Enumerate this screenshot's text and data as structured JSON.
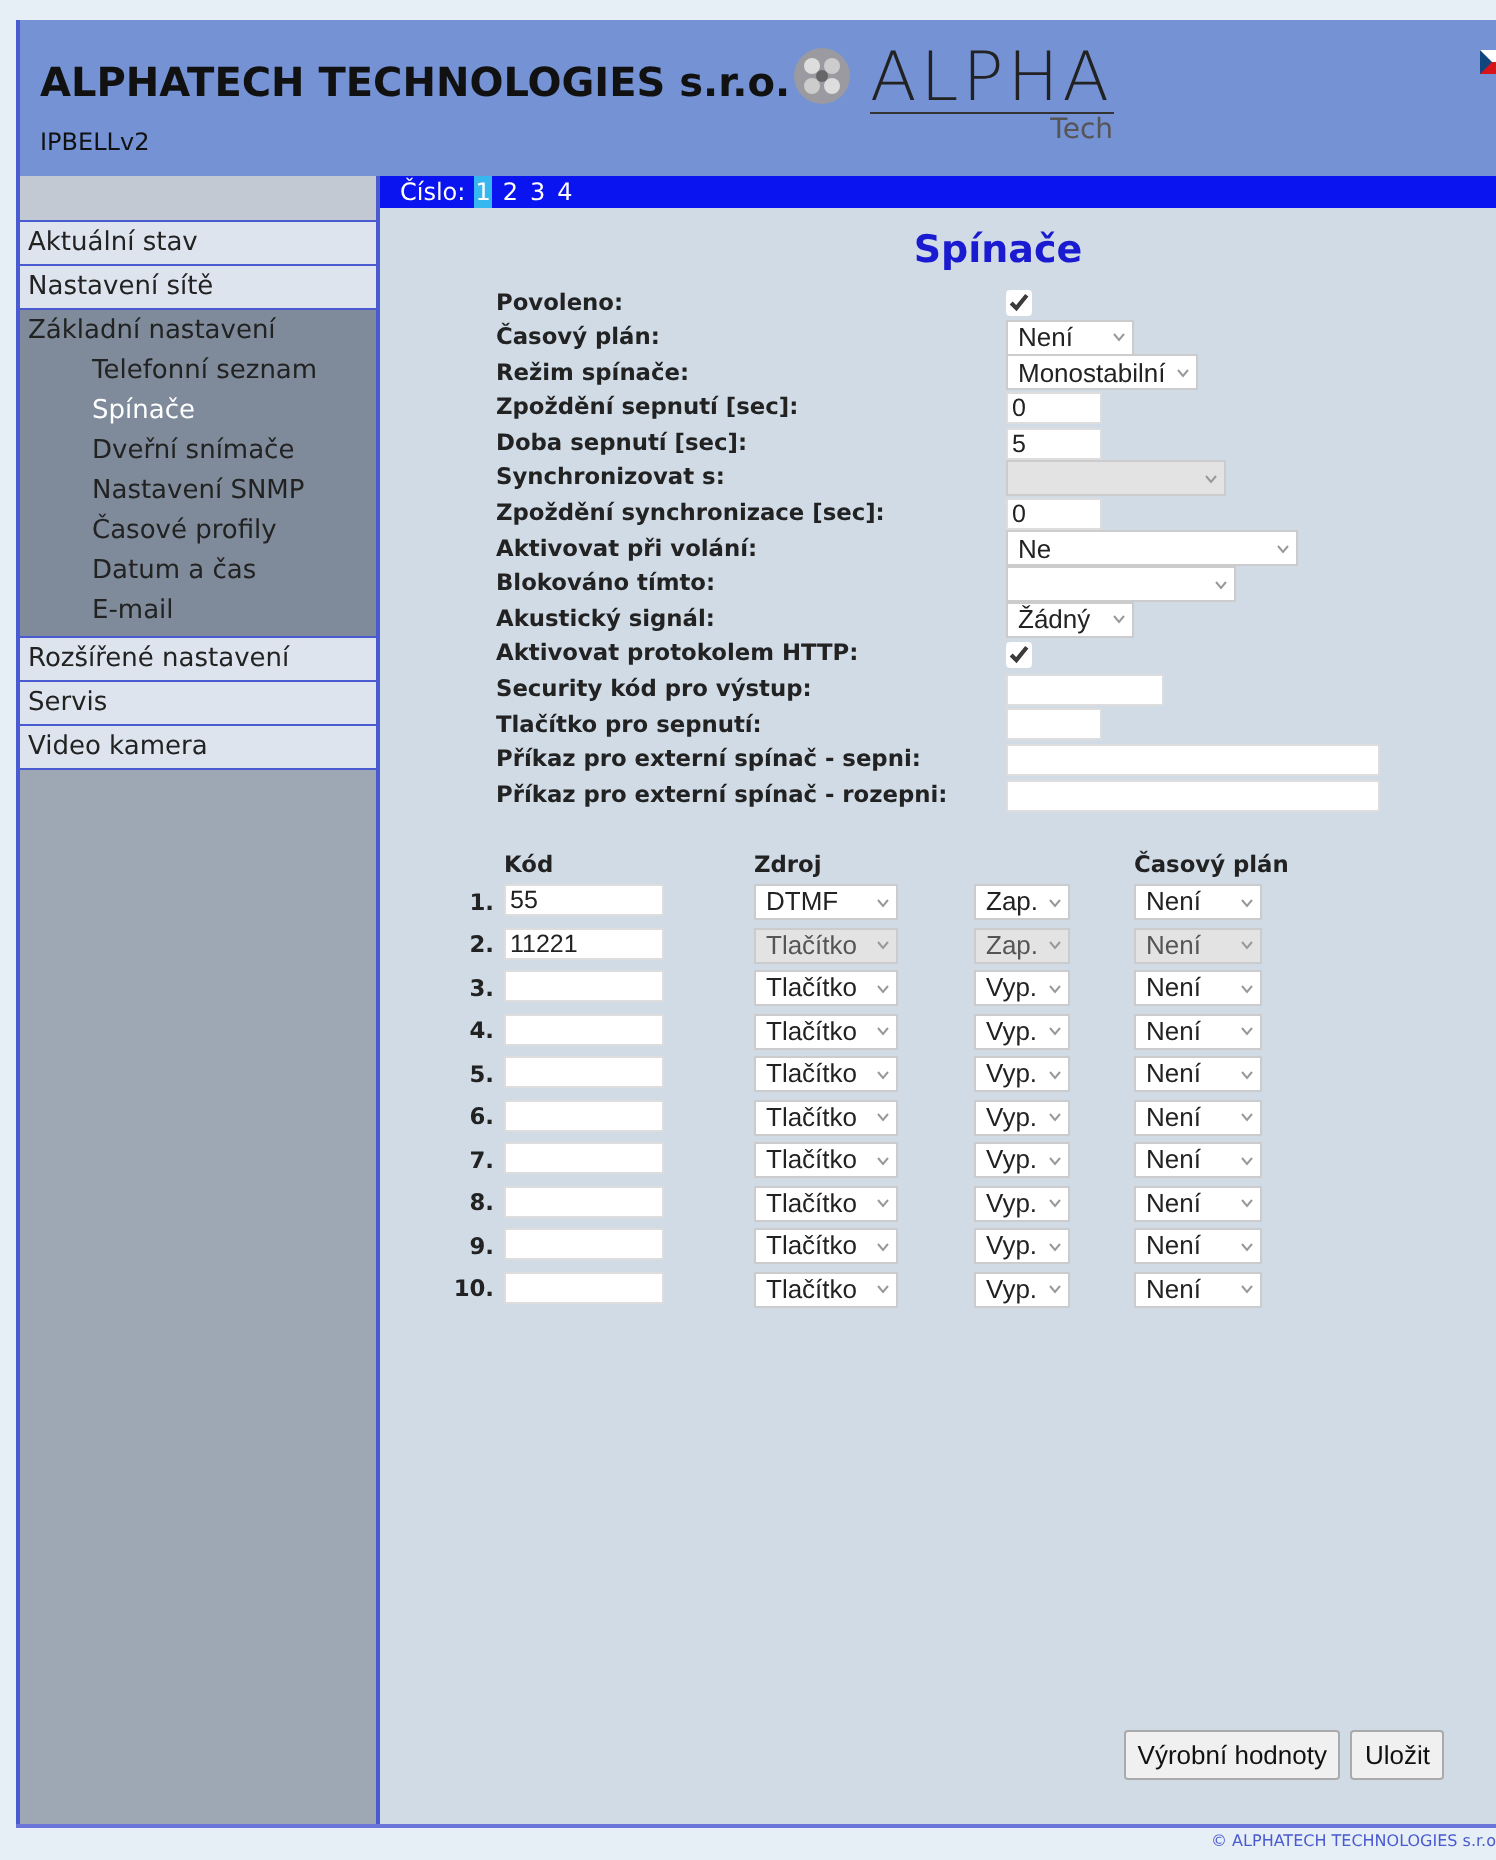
{
  "header": {
    "company": "ALPHATECH TECHNOLOGIES s.r.o.",
    "device": "IPBELLv2",
    "logo_text": "ALPHA",
    "logo_subtext": "Tech"
  },
  "number_bar": {
    "label": "Číslo:",
    "numbers": [
      {
        "label": "1",
        "selected": true
      },
      {
        "label": "2",
        "selected": false
      },
      {
        "label": "3",
        "selected": false
      },
      {
        "label": "4",
        "selected": false
      }
    ]
  },
  "sidebar": {
    "items": [
      {
        "label": "Aktuální stav",
        "expanded": false
      },
      {
        "label": "Nastavení sítě",
        "expanded": false
      },
      {
        "label": "Základní nastavení",
        "expanded": true,
        "children": [
          {
            "label": "Telefonní seznam",
            "selected": false
          },
          {
            "label": "Spínače",
            "selected": true
          },
          {
            "label": "Dveřní snímače",
            "selected": false
          },
          {
            "label": "Nastavení SNMP",
            "selected": false
          },
          {
            "label": "Časové profily",
            "selected": false
          },
          {
            "label": "Datum a čas",
            "selected": false
          },
          {
            "label": "E-mail",
            "selected": false
          }
        ]
      },
      {
        "label": "Rozšířené nastavení",
        "expanded": false
      },
      {
        "label": "Servis",
        "expanded": false
      },
      {
        "label": "Video kamera",
        "expanded": false
      }
    ]
  },
  "title": "Spínače",
  "fields": [
    {
      "label": "Povoleno:",
      "kind": "checkbox",
      "checked": true
    },
    {
      "label": "Časový plán:",
      "kind": "select",
      "value": "Není",
      "disabled": false
    },
    {
      "label": "Režim spínače:",
      "kind": "select",
      "value": "Monostabilní",
      "disabled": false
    },
    {
      "label": "Zpoždění sepnutí [sec]:",
      "kind": "input",
      "value": "0"
    },
    {
      "label": "Doba sepnutí [sec]:",
      "kind": "input",
      "value": "5"
    },
    {
      "label": "Synchronizovat s:",
      "kind": "select",
      "disabled": true
    },
    {
      "label": "Zpoždění synchronizace [sec]:",
      "kind": "input",
      "value": "0"
    },
    {
      "label": "Aktivovat při volání:",
      "kind": "select",
      "value": "Ne",
      "disabled": false
    },
    {
      "label": "Blokováno tímto:",
      "kind": "select",
      "disabled": false
    },
    {
      "label": "Akustický signál:",
      "kind": "select",
      "value": "Žádný",
      "disabled": false
    },
    {
      "label": "Aktivovat protokolem HTTP:",
      "kind": "checkbox",
      "checked": true
    },
    {
      "label": "Security kód pro výstup:",
      "kind": "input"
    },
    {
      "label": "Tlačítko pro sepnutí:",
      "kind": "input"
    },
    {
      "label": "Příkaz pro externí spínač - sepni:",
      "kind": "input"
    },
    {
      "label": "Příkaz pro externí spínač - rozepni:",
      "kind": "input"
    }
  ],
  "table": {
    "columns": {
      "code": "Kód",
      "source": "Zdroj",
      "schedule": "Časový plán"
    },
    "rows": [
      {
        "number": "1.",
        "code": "55",
        "source": "DTMF",
        "state": "Zap.",
        "schedule": "Není",
        "disabled": false
      },
      {
        "number": "2.",
        "code": "11221",
        "source": "Tlačítko",
        "state": "Zap.",
        "schedule": "Není",
        "disabled": true
      },
      {
        "number": "3.",
        "source": "Tlačítko",
        "state": "Vyp.",
        "schedule": "Není",
        "disabled": false
      },
      {
        "number": "4.",
        "source": "Tlačítko",
        "state": "Vyp.",
        "schedule": "Není",
        "disabled": false
      },
      {
        "number": "5.",
        "source": "Tlačítko",
        "state": "Vyp.",
        "schedule": "Není",
        "disabled": false
      },
      {
        "number": "6.",
        "source": "Tlačítko",
        "state": "Vyp.",
        "schedule": "Není",
        "disabled": false
      },
      {
        "number": "7.",
        "source": "Tlačítko",
        "state": "Vyp.",
        "schedule": "Není",
        "disabled": false
      },
      {
        "number": "8.",
        "source": "Tlačítko",
        "state": "Vyp.",
        "schedule": "Není",
        "disabled": false
      },
      {
        "number": "9.",
        "source": "Tlačítko",
        "state": "Vyp.",
        "schedule": "Není",
        "disabled": false
      },
      {
        "number": "10.",
        "source": "Tlačítko",
        "state": "Vyp.",
        "schedule": "Není",
        "disabled": false
      }
    ]
  },
  "buttons": [
    "Výrobní hodnoty",
    "Uložit"
  ],
  "footer": "© ALPHATECH TECHNOLOGIES s.r.o"
}
